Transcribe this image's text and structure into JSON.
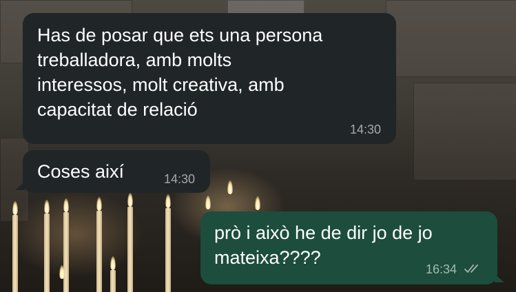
{
  "messages": [
    {
      "direction": "incoming",
      "text": "Has de posar que ets una persona\ntreballadora, amb molts\ninteressos, molt creativa, amb\ncapacitat de relació",
      "time": "14:30"
    },
    {
      "direction": "incoming",
      "text": "Coses així",
      "time": "14:30"
    },
    {
      "direction": "outgoing",
      "text": "prò i això he de dir jo de jo\nmateixa????",
      "time": "16:34",
      "status_icon": "double-check-icon"
    }
  ],
  "colors": {
    "incoming_bubble": "#202528",
    "outgoing_bubble": "#1d4d3c",
    "text": "#ffffff",
    "meta": "#9aa0a3"
  }
}
